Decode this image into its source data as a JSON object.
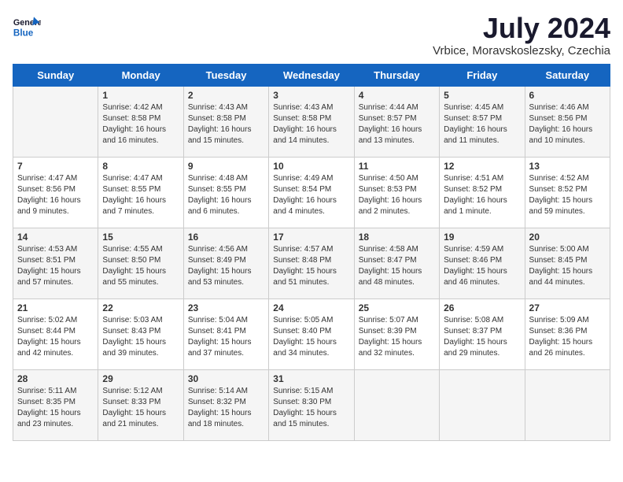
{
  "header": {
    "logo_line1": "General",
    "logo_line2": "Blue",
    "month_year": "July 2024",
    "location": "Vrbice, Moravskoslezsky, Czechia"
  },
  "days_of_week": [
    "Sunday",
    "Monday",
    "Tuesday",
    "Wednesday",
    "Thursday",
    "Friday",
    "Saturday"
  ],
  "weeks": [
    [
      {
        "day": "",
        "content": ""
      },
      {
        "day": "1",
        "content": "Sunrise: 4:42 AM\nSunset: 8:58 PM\nDaylight: 16 hours\nand 16 minutes."
      },
      {
        "day": "2",
        "content": "Sunrise: 4:43 AM\nSunset: 8:58 PM\nDaylight: 16 hours\nand 15 minutes."
      },
      {
        "day": "3",
        "content": "Sunrise: 4:43 AM\nSunset: 8:58 PM\nDaylight: 16 hours\nand 14 minutes."
      },
      {
        "day": "4",
        "content": "Sunrise: 4:44 AM\nSunset: 8:57 PM\nDaylight: 16 hours\nand 13 minutes."
      },
      {
        "day": "5",
        "content": "Sunrise: 4:45 AM\nSunset: 8:57 PM\nDaylight: 16 hours\nand 11 minutes."
      },
      {
        "day": "6",
        "content": "Sunrise: 4:46 AM\nSunset: 8:56 PM\nDaylight: 16 hours\nand 10 minutes."
      }
    ],
    [
      {
        "day": "7",
        "content": "Sunrise: 4:47 AM\nSunset: 8:56 PM\nDaylight: 16 hours\nand 9 minutes."
      },
      {
        "day": "8",
        "content": "Sunrise: 4:47 AM\nSunset: 8:55 PM\nDaylight: 16 hours\nand 7 minutes."
      },
      {
        "day": "9",
        "content": "Sunrise: 4:48 AM\nSunset: 8:55 PM\nDaylight: 16 hours\nand 6 minutes."
      },
      {
        "day": "10",
        "content": "Sunrise: 4:49 AM\nSunset: 8:54 PM\nDaylight: 16 hours\nand 4 minutes."
      },
      {
        "day": "11",
        "content": "Sunrise: 4:50 AM\nSunset: 8:53 PM\nDaylight: 16 hours\nand 2 minutes."
      },
      {
        "day": "12",
        "content": "Sunrise: 4:51 AM\nSunset: 8:52 PM\nDaylight: 16 hours\nand 1 minute."
      },
      {
        "day": "13",
        "content": "Sunrise: 4:52 AM\nSunset: 8:52 PM\nDaylight: 15 hours\nand 59 minutes."
      }
    ],
    [
      {
        "day": "14",
        "content": "Sunrise: 4:53 AM\nSunset: 8:51 PM\nDaylight: 15 hours\nand 57 minutes."
      },
      {
        "day": "15",
        "content": "Sunrise: 4:55 AM\nSunset: 8:50 PM\nDaylight: 15 hours\nand 55 minutes."
      },
      {
        "day": "16",
        "content": "Sunrise: 4:56 AM\nSunset: 8:49 PM\nDaylight: 15 hours\nand 53 minutes."
      },
      {
        "day": "17",
        "content": "Sunrise: 4:57 AM\nSunset: 8:48 PM\nDaylight: 15 hours\nand 51 minutes."
      },
      {
        "day": "18",
        "content": "Sunrise: 4:58 AM\nSunset: 8:47 PM\nDaylight: 15 hours\nand 48 minutes."
      },
      {
        "day": "19",
        "content": "Sunrise: 4:59 AM\nSunset: 8:46 PM\nDaylight: 15 hours\nand 46 minutes."
      },
      {
        "day": "20",
        "content": "Sunrise: 5:00 AM\nSunset: 8:45 PM\nDaylight: 15 hours\nand 44 minutes."
      }
    ],
    [
      {
        "day": "21",
        "content": "Sunrise: 5:02 AM\nSunset: 8:44 PM\nDaylight: 15 hours\nand 42 minutes."
      },
      {
        "day": "22",
        "content": "Sunrise: 5:03 AM\nSunset: 8:43 PM\nDaylight: 15 hours\nand 39 minutes."
      },
      {
        "day": "23",
        "content": "Sunrise: 5:04 AM\nSunset: 8:41 PM\nDaylight: 15 hours\nand 37 minutes."
      },
      {
        "day": "24",
        "content": "Sunrise: 5:05 AM\nSunset: 8:40 PM\nDaylight: 15 hours\nand 34 minutes."
      },
      {
        "day": "25",
        "content": "Sunrise: 5:07 AM\nSunset: 8:39 PM\nDaylight: 15 hours\nand 32 minutes."
      },
      {
        "day": "26",
        "content": "Sunrise: 5:08 AM\nSunset: 8:37 PM\nDaylight: 15 hours\nand 29 minutes."
      },
      {
        "day": "27",
        "content": "Sunrise: 5:09 AM\nSunset: 8:36 PM\nDaylight: 15 hours\nand 26 minutes."
      }
    ],
    [
      {
        "day": "28",
        "content": "Sunrise: 5:11 AM\nSunset: 8:35 PM\nDaylight: 15 hours\nand 23 minutes."
      },
      {
        "day": "29",
        "content": "Sunrise: 5:12 AM\nSunset: 8:33 PM\nDaylight: 15 hours\nand 21 minutes."
      },
      {
        "day": "30",
        "content": "Sunrise: 5:14 AM\nSunset: 8:32 PM\nDaylight: 15 hours\nand 18 minutes."
      },
      {
        "day": "31",
        "content": "Sunrise: 5:15 AM\nSunset: 8:30 PM\nDaylight: 15 hours\nand 15 minutes."
      },
      {
        "day": "",
        "content": ""
      },
      {
        "day": "",
        "content": ""
      },
      {
        "day": "",
        "content": ""
      }
    ]
  ]
}
